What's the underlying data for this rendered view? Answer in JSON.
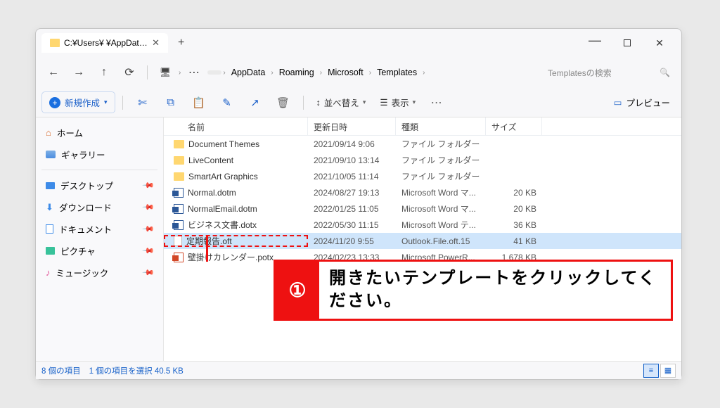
{
  "tab": {
    "title": "C:¥Users¥    ¥AppData¥Roan"
  },
  "breadcrumb": {
    "user": "    ",
    "p1": "AppData",
    "p2": "Roaming",
    "p3": "Microsoft",
    "p4": "Templates"
  },
  "search": {
    "placeholder": "Templatesの検索"
  },
  "toolbar": {
    "new": "新規作成",
    "sort": "並べ替え",
    "view": "表示",
    "preview": "プレビュー"
  },
  "sidebar": {
    "home": "ホーム",
    "gallery": "ギャラリー",
    "desktop": "デスクトップ",
    "downloads": "ダウンロード",
    "documents": "ドキュメント",
    "pictures": "ピクチャ",
    "music": "ミュージック"
  },
  "columns": {
    "name": "名前",
    "date": "更新日時",
    "type": "種類",
    "size": "サイズ"
  },
  "files": [
    {
      "icon": "folder",
      "name": "Document Themes",
      "date": "2021/09/14 9:06",
      "type": "ファイル フォルダー",
      "size": ""
    },
    {
      "icon": "folder",
      "name": "LiveContent",
      "date": "2021/09/10 13:14",
      "type": "ファイル フォルダー",
      "size": ""
    },
    {
      "icon": "folder",
      "name": "SmartArt Graphics",
      "date": "2021/10/05 11:14",
      "type": "ファイル フォルダー",
      "size": ""
    },
    {
      "icon": "word",
      "name": "Normal.dotm",
      "date": "2024/08/27 19:13",
      "type": "Microsoft Word マ...",
      "size": "20 KB"
    },
    {
      "icon": "word",
      "name": "NormalEmail.dotm",
      "date": "2022/01/25 11:05",
      "type": "Microsoft Word マ...",
      "size": "20 KB"
    },
    {
      "icon": "word",
      "name": "ビジネス文書.dotx",
      "date": "2022/05/30 11:15",
      "type": "Microsoft Word テ...",
      "size": "36 KB"
    },
    {
      "icon": "file",
      "name": "定期報告.oft",
      "date": "2024/11/20 9:55",
      "type": "Outlook.File.oft.15",
      "size": "41 KB",
      "selected": true
    },
    {
      "icon": "ppt",
      "name": "壁掛けカレンダー.potx",
      "date": "2024/02/23 13:33",
      "type": "Microsoft PowerR...",
      "size": "1,678 KB"
    }
  ],
  "status": {
    "count": "8 個の項目",
    "selection": "1 個の項目を選択 40.5 KB"
  },
  "annotation": {
    "num": "①",
    "text": "開きたいテンプレートをクリックしてください。"
  }
}
